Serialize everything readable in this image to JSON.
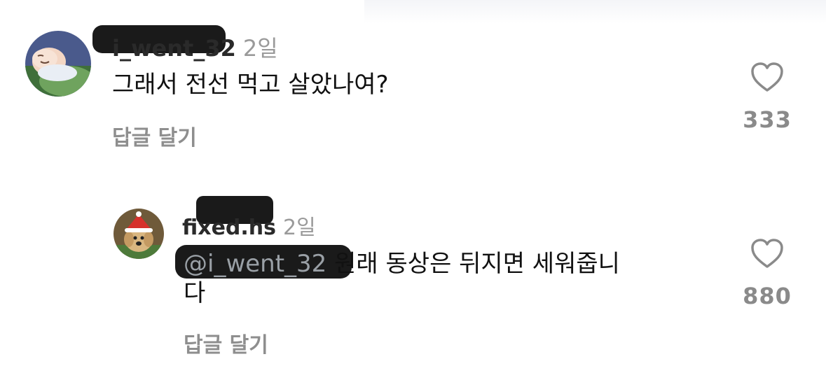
{
  "comments": [
    {
      "username": "i_went_32",
      "time": "2일",
      "text": "그래서 전선 먹고 살았나여?",
      "reply_label": "답글 달기",
      "likes": "333",
      "avatar_icon": "sleeping-cartoon-avatar"
    },
    {
      "username": "fixed.hs",
      "time": "2일",
      "mention": "@i_went_32",
      "text_line1": "원래 동상은 뒤지면 세워줍니",
      "text_line2": "다",
      "reply_label": "답글 달기",
      "likes": "880",
      "avatar_icon": "dog-santa-hat-avatar"
    }
  ],
  "colors": {
    "muted": "#8e8e8e",
    "time": "#9a9a9a",
    "text": "#111111",
    "heart_stroke": "#8a8a8a"
  }
}
